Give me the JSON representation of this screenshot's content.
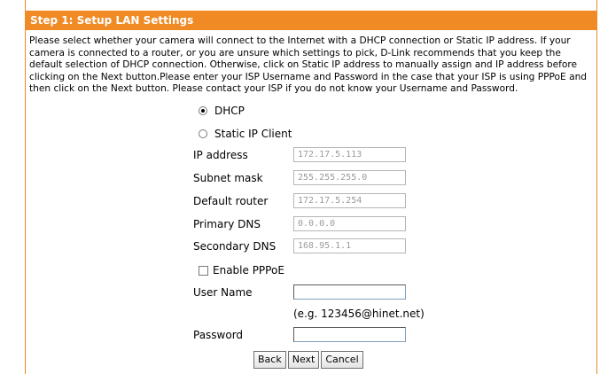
{
  "header": {
    "title": "Step 1: Setup LAN Settings"
  },
  "description": "Please select whether your camera will connect to the Internet with a DHCP connection or Static IP address. If your camera is connected to a router, or you are unsure which settings to pick, D-Link recommends that you keep the default selection of DHCP connection. Otherwise, click on Static IP address to manually assign and IP address before clicking on the Next button.Please enter your ISP Username and Password in the case that your ISP is using PPPoE and then click on the Next button. Please contact your ISP if you do not know your Username and Password.",
  "connection": {
    "dhcp_label": "DHCP",
    "static_label": "Static IP Client",
    "selected": "DHCP"
  },
  "static": {
    "ip_label": "IP address",
    "ip_value": "172.17.5.113",
    "subnet_label": "Subnet mask",
    "subnet_value": "255.255.255.0",
    "router_label": "Default router",
    "router_value": "172.17.5.254",
    "dns1_label": "Primary DNS",
    "dns1_value": "0.0.0.0",
    "dns2_label": "Secondary DNS",
    "dns2_value": "168.95.1.1"
  },
  "pppoe": {
    "enable_label": "Enable PPPoE",
    "enabled": false,
    "username_label": "User Name",
    "username_value": "",
    "username_hint": "(e.g. 123456@hinet.net)",
    "password_label": "Password",
    "password_value": ""
  },
  "buttons": {
    "back": "Back",
    "next": "Next",
    "cancel": "Cancel"
  },
  "colors": {
    "header_bg": "#f08a24",
    "border": "#e8882a"
  }
}
